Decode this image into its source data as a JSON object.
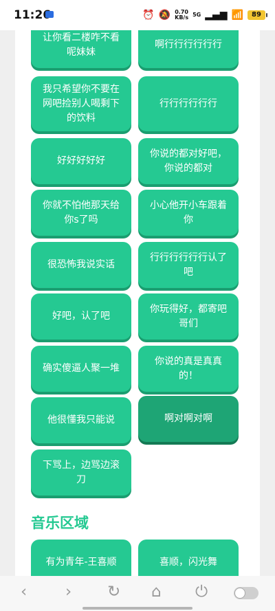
{
  "status_bar": {
    "time": "11:26",
    "net_speed": "0.70",
    "net_speed_unit": "KB/s",
    "signal_type": "5G",
    "battery": "89"
  },
  "phrase_buttons": [
    {
      "label": "让你看二楼咋不看呢妹妹"
    },
    {
      "label": "啊行行行行行行"
    },
    {
      "label": "我只希望你不要在网吧捡别人喝剩下的饮料"
    },
    {
      "label": "行行行行行行"
    },
    {
      "label": "好好好好好"
    },
    {
      "label": "你说的都对好吧，你说的都对"
    },
    {
      "label": "你就不怕他那天给你s了吗"
    },
    {
      "label": "小心他开小车跟着你"
    },
    {
      "label": "很恐怖我说实话"
    },
    {
      "label": "行行行行行行认了吧"
    },
    {
      "label": "好吧，认了吧"
    },
    {
      "label": "你玩得好，都寄吧哥们"
    },
    {
      "label": "确实傻逼人聚一堆"
    },
    {
      "label": "你说的真是真真的！"
    },
    {
      "label": "他很懂我只能说"
    },
    {
      "label": "啊对啊对啊",
      "active": true
    },
    {
      "label": "下骂上，边骂边滚刀"
    }
  ],
  "music_section": {
    "title": "音乐区域",
    "buttons": [
      {
        "label": "有为青年-王喜顺"
      },
      {
        "label": "喜顺，闪光舞"
      }
    ]
  },
  "nav_icons": [
    "back-icon",
    "forward-icon",
    "refresh-icon",
    "home-icon",
    "power-icon",
    "toggle-switch"
  ]
}
